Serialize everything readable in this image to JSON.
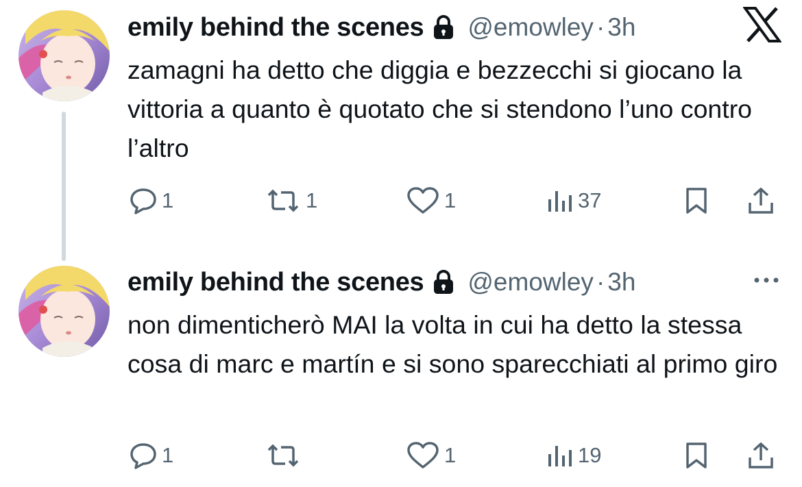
{
  "tweets": [
    {
      "name": "emily behind the scenes",
      "handle": "@emowley",
      "separator": "·",
      "time": "3h",
      "text": "zamagni ha detto che diggia e bezzecchi si giocano la vittoria a quanto è quotato che si stendono l’uno contro l’altro",
      "replies": "1",
      "reposts": "1",
      "likes": "1",
      "views": "37",
      "corner_icon": "x-logo-icon"
    },
    {
      "name": "emily behind the scenes",
      "handle": "@emowley",
      "separator": "·",
      "time": "3h",
      "text": "non dimenticherò MAI la volta in cui ha detto la stessa cosa di marc e martín e si sono sparecchiati al primo giro",
      "replies": "1",
      "reposts": "",
      "likes": "1",
      "views": "19",
      "corner_icon": "more-icon"
    }
  ],
  "colors": {
    "text": "#0f1419",
    "secondary": "#536471",
    "thread_line": "#cfd9de",
    "background": "#ffffff"
  }
}
